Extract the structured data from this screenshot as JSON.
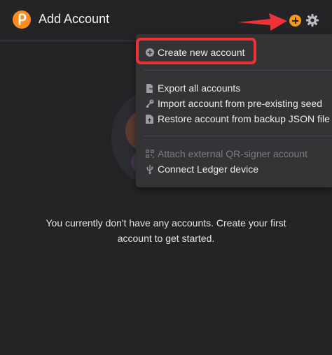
{
  "header": {
    "title": "Add Account",
    "logo_icon": "polkadot-logo-icon",
    "add_icon": "plus-circle-icon",
    "settings_icon": "gear-icon"
  },
  "main": {
    "empty_message_line1": "You currently don't have any accounts. Create your first",
    "empty_message_line2": "account to get started."
  },
  "menu": {
    "create": "Create new account",
    "export": "Export all accounts",
    "import_seed": "Import account from pre-existing seed",
    "restore": "Restore account from backup JSON file",
    "attach_qr": "Attach external QR-signer account",
    "ledger": "Connect Ledger device"
  },
  "colors": {
    "background": "#242427",
    "menu_background": "#343437",
    "accent_orange": "#f39a12",
    "highlight_red": "#ee3338"
  }
}
